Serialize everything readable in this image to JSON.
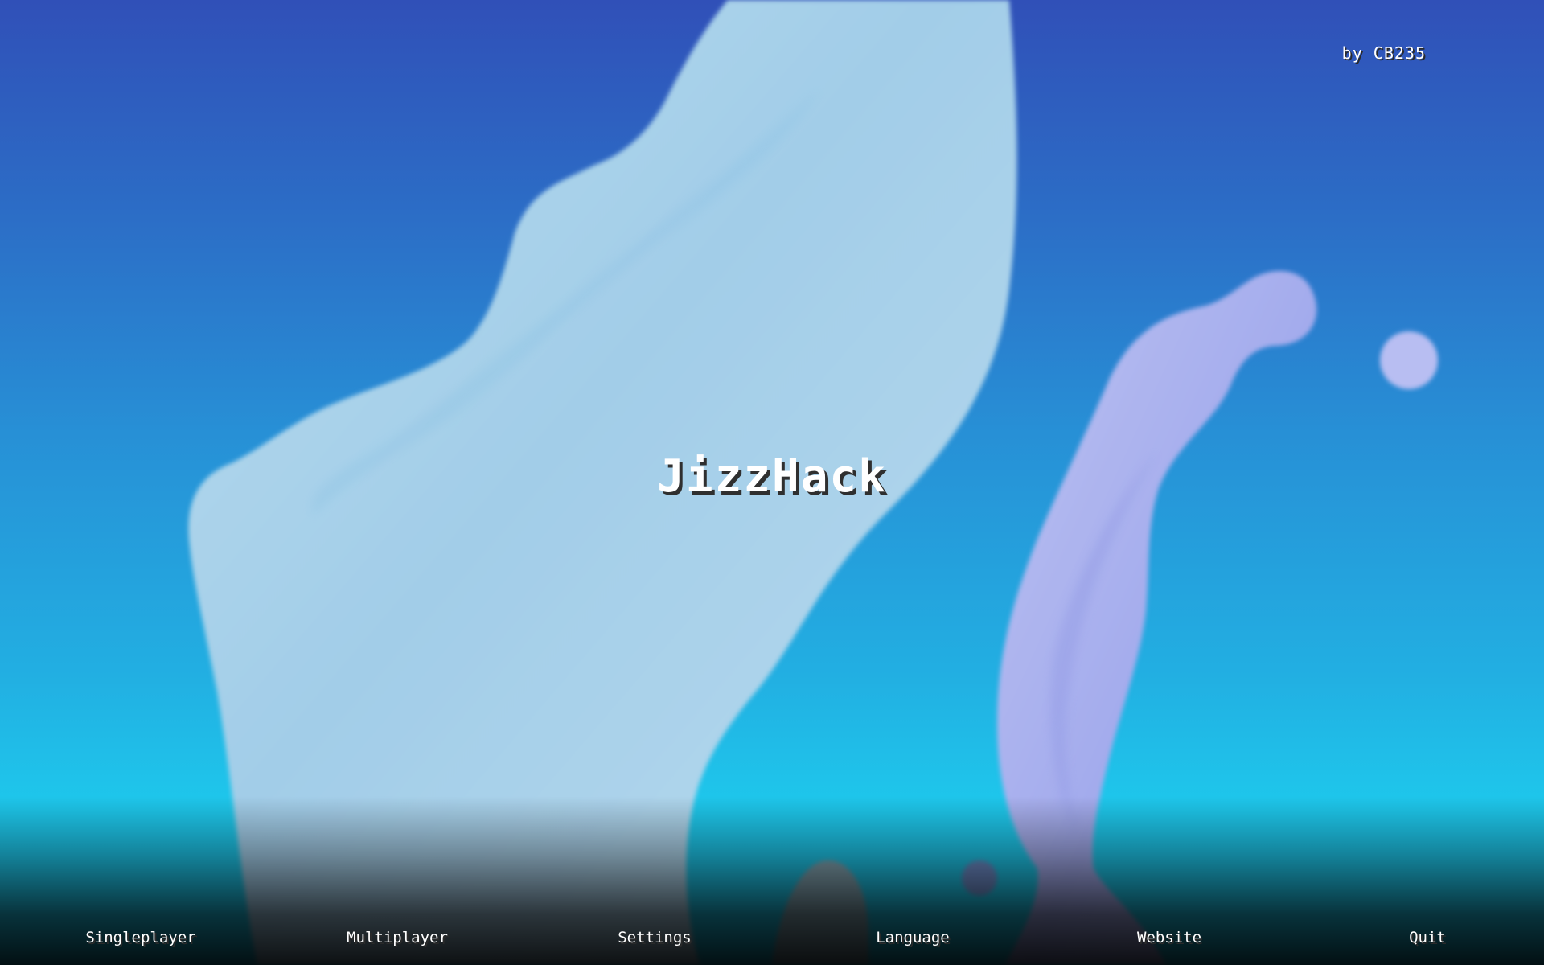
{
  "header": {
    "author": "by CB235"
  },
  "main": {
    "title": "JizzHack"
  },
  "menu": {
    "items": [
      {
        "label": "Singleplayer"
      },
      {
        "label": "Multiplayer"
      },
      {
        "label": "Settings"
      },
      {
        "label": "Language"
      },
      {
        "label": "Website"
      },
      {
        "label": "Quit"
      }
    ]
  },
  "colors": {
    "background_top": "#3050b8",
    "background_bottom": "#1ec8ec",
    "ribbon_light_blue": "#a9d3ea",
    "ribbon_lavender": "#a8b0ee",
    "text": "#ffffff",
    "text_shadow": "#2a2a2a"
  }
}
